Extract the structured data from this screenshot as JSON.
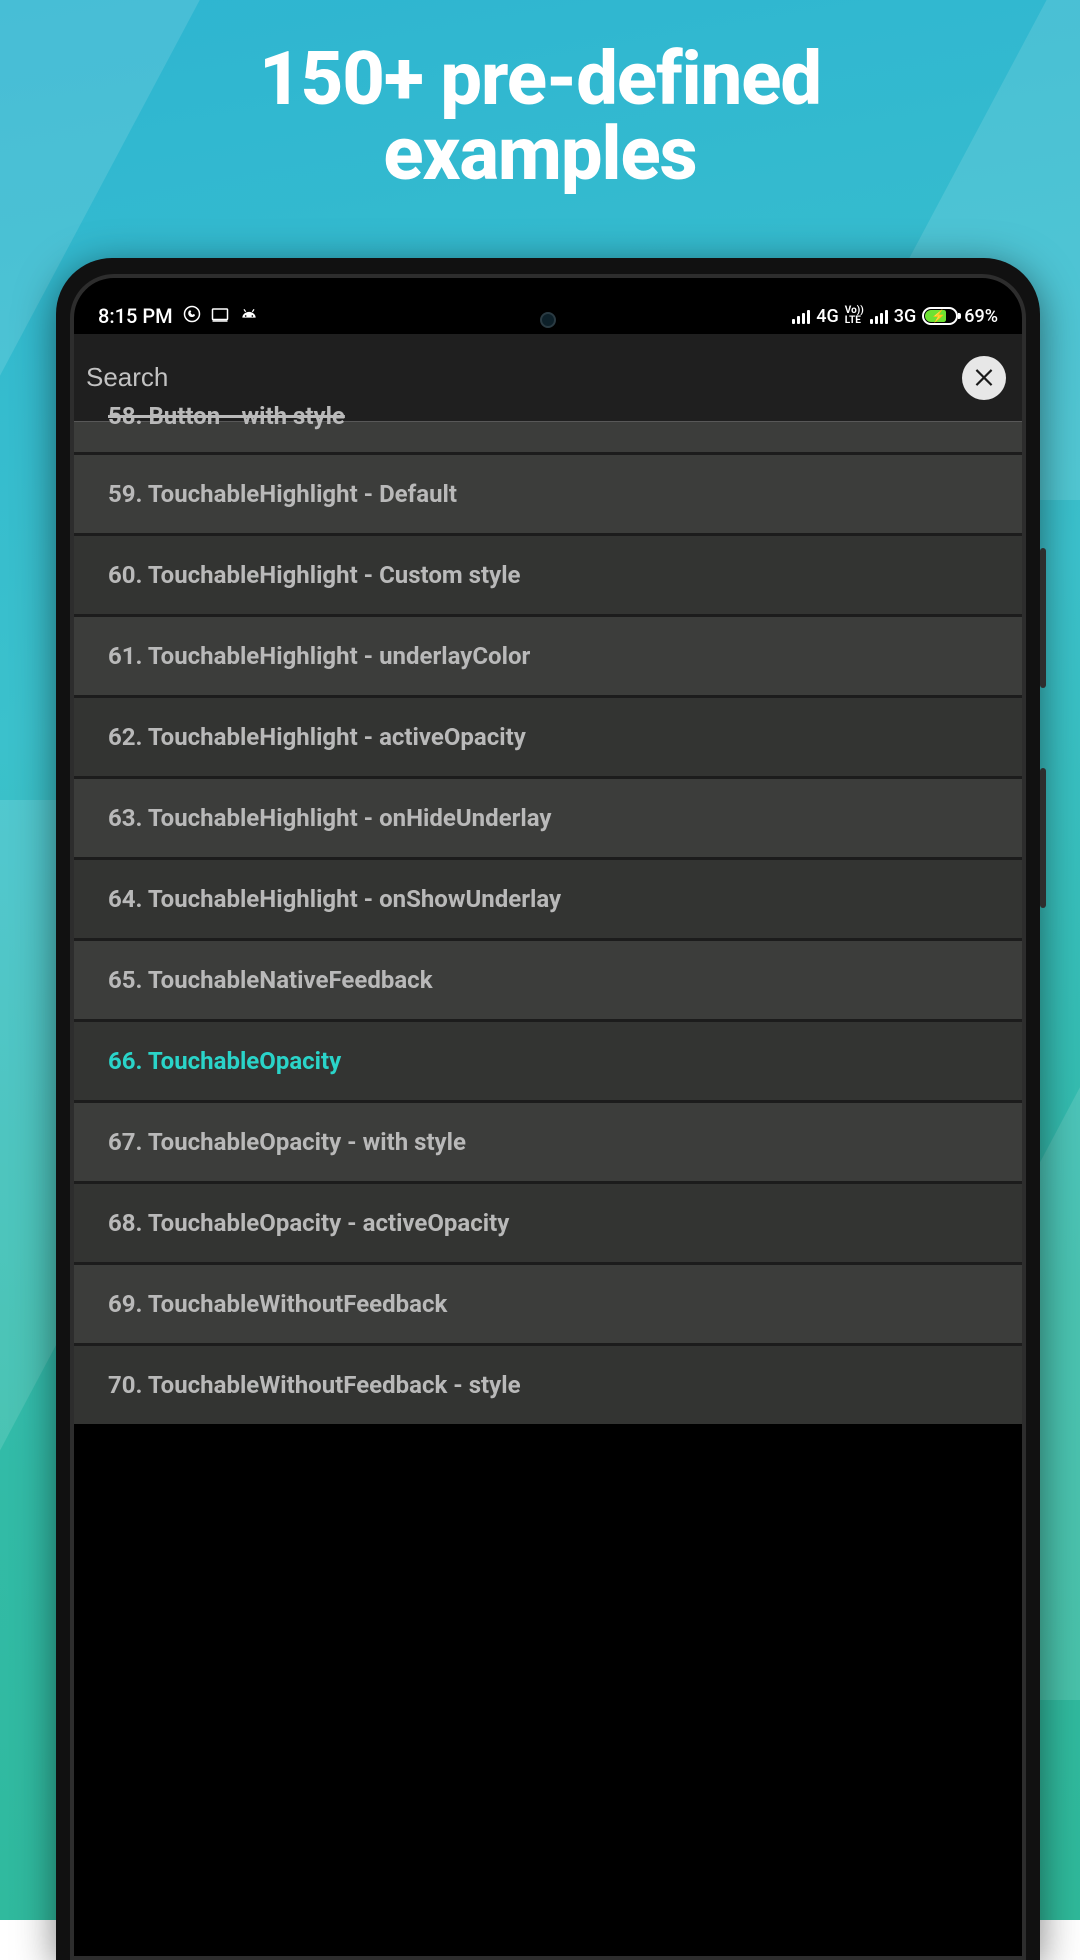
{
  "headline_line1": "150+ pre-defined",
  "headline_line2": "examples",
  "statusbar": {
    "time": "8:15 PM",
    "net1": "4G",
    "volte": "Vo))\nLTE",
    "net2": "3G",
    "battery_pct": "69%"
  },
  "search": {
    "placeholder": "Search"
  },
  "list": [
    {
      "label": "58. Button - with style",
      "partial": true
    },
    {
      "label": "59. TouchableHighlight - Default"
    },
    {
      "label": "60. TouchableHighlight - Custom style"
    },
    {
      "label": "61. TouchableHighlight - underlayColor"
    },
    {
      "label": "62. TouchableHighlight - activeOpacity"
    },
    {
      "label": "63. TouchableHighlight - onHideUnderlay"
    },
    {
      "label": "64. TouchableHighlight - onShowUnderlay"
    },
    {
      "label": "65. TouchableNativeFeedback"
    },
    {
      "label": "66. TouchableOpacity",
      "highlight": true
    },
    {
      "label": "67. TouchableOpacity - with style"
    },
    {
      "label": "68. TouchableOpacity - activeOpacity"
    },
    {
      "label": "69. TouchableWithoutFeedback"
    },
    {
      "label": "70. TouchableWithoutFeedback - style"
    }
  ]
}
